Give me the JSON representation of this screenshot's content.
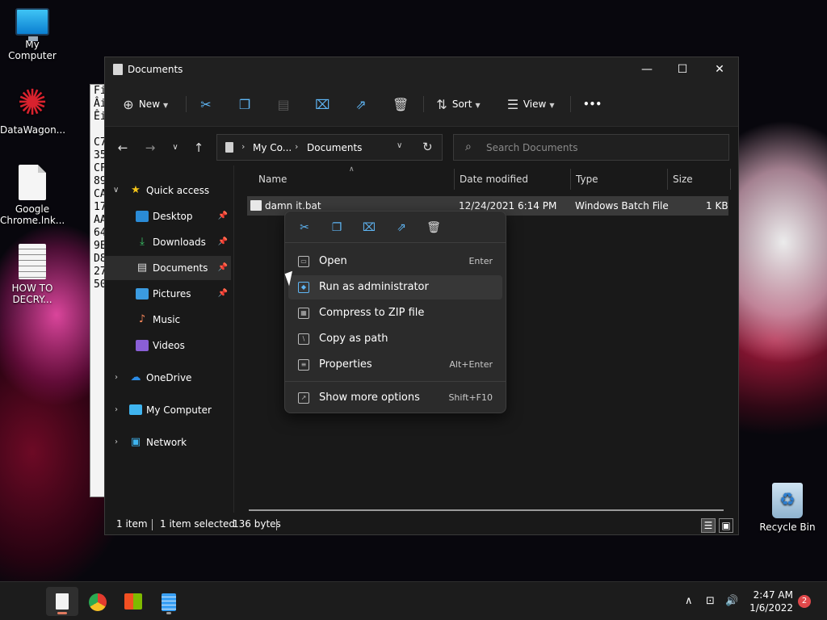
{
  "desktop": {
    "icons": [
      {
        "label": "My Computer"
      },
      {
        "label": "DataWagon..."
      },
      {
        "label": "Google Chrome.lnk..."
      },
      {
        "label": "HOW TO DECRY..."
      },
      {
        "label": "Recycle Bin"
      }
    ]
  },
  "notepad_lines": [
    "Fi",
    "Âi",
    "Êi",
    "",
    "C7",
    "35",
    "CF",
    "89",
    "CA",
    "17",
    "AA",
    "64",
    "9E",
    "D8",
    "27",
    "50"
  ],
  "window": {
    "title": "Documents",
    "minimize": "—",
    "maximize": "☐",
    "close": "✕"
  },
  "toolbar": {
    "new_label": "New",
    "sort_label": "Sort",
    "view_label": "View",
    "more_label": "•••"
  },
  "address": {
    "crumbs": [
      "My Co...",
      "Documents"
    ]
  },
  "search": {
    "placeholder": "Search Documents"
  },
  "sidebar": {
    "items": [
      {
        "label": "Quick access"
      },
      {
        "label": "Desktop"
      },
      {
        "label": "Downloads"
      },
      {
        "label": "Documents"
      },
      {
        "label": "Pictures"
      },
      {
        "label": "Music"
      },
      {
        "label": "Videos"
      },
      {
        "label": "OneDrive"
      },
      {
        "label": "My Computer"
      },
      {
        "label": "Network"
      }
    ]
  },
  "columns": [
    "Name",
    "Date modified",
    "Type",
    "Size"
  ],
  "files": [
    {
      "name": "damn it.bat",
      "date": "12/24/2021 6:14 PM",
      "type": "Windows Batch File",
      "size": "1 KB"
    }
  ],
  "status": {
    "count": "1 item",
    "selected": "1 item selected",
    "size": "136 bytes"
  },
  "context_menu": {
    "items": [
      {
        "label": "Open",
        "shortcut": "Enter"
      },
      {
        "label": "Run as administrator",
        "shortcut": ""
      },
      {
        "label": "Compress to ZIP file",
        "shortcut": ""
      },
      {
        "label": "Copy as path",
        "shortcut": ""
      },
      {
        "label": "Properties",
        "shortcut": "Alt+Enter"
      },
      {
        "label": "Show more options",
        "shortcut": "Shift+F10"
      }
    ]
  },
  "taskbar": {
    "time": "2:47 AM",
    "date": "1/6/2022",
    "notifications": "2"
  },
  "colors": {
    "accent": "#5fb6f5",
    "window_bg": "#191919",
    "menu_bg": "#2b2b2b"
  }
}
